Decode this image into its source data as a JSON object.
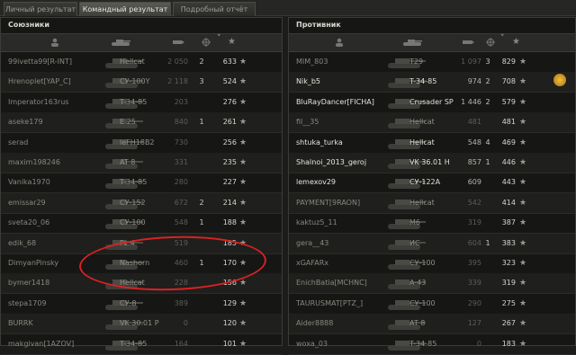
{
  "tabs": [
    {
      "label": "Личный результат",
      "active": false
    },
    {
      "label": "Командный результат",
      "active": true
    },
    {
      "label": "Подробный отчёт",
      "active": false
    }
  ],
  "allies": {
    "title": "Союзники",
    "rows": [
      {
        "name": "99ivetta99[R-INT]",
        "vehicle": "Hellcat",
        "damage": "2 050",
        "kills": "2",
        "xp": "633",
        "bright": false
      },
      {
        "name": "Hrenoplet[YAP_C]",
        "vehicle": "СУ-100Y",
        "damage": "2 118",
        "kills": "3",
        "xp": "524",
        "bright": false
      },
      {
        "name": "Imperator163rus",
        "vehicle": "T-34-85",
        "damage": "203",
        "kills": "",
        "xp": "276",
        "bright": false
      },
      {
        "name": "aseke179",
        "vehicle": "E 25",
        "damage": "840",
        "kills": "1",
        "xp": "261",
        "bright": false
      },
      {
        "name": "serad",
        "vehicle": "leFH18B2",
        "damage": "730",
        "kills": "",
        "xp": "256",
        "bright": false
      },
      {
        "name": "maxim198246",
        "vehicle": "AT 8",
        "damage": "331",
        "kills": "",
        "xp": "235",
        "bright": false
      },
      {
        "name": "Vanika1970",
        "vehicle": "T-34-85",
        "damage": "280",
        "kills": "",
        "xp": "227",
        "bright": false
      },
      {
        "name": "emissar29",
        "vehicle": "СУ-152",
        "damage": "672",
        "kills": "2",
        "xp": "214",
        "bright": false
      },
      {
        "name": "sveta20_06",
        "vehicle": "СУ-100",
        "damage": "548",
        "kills": "1",
        "xp": "188",
        "bright": false
      },
      {
        "name": "edik_68",
        "vehicle": "Pz.4",
        "damage": "519",
        "kills": "",
        "xp": "185",
        "bright": false
      },
      {
        "name": "DimyanPinsky",
        "vehicle": "Nashorn",
        "damage": "460",
        "kills": "1",
        "xp": "170",
        "bright": false
      },
      {
        "name": "bymer1418",
        "vehicle": "Hellcat",
        "damage": "228",
        "kills": "",
        "xp": "156",
        "bright": false
      },
      {
        "name": "stepa1709",
        "vehicle": "СУ-8",
        "damage": "389",
        "kills": "",
        "xp": "129",
        "bright": false
      },
      {
        "name": "BURRK",
        "vehicle": "VK 30.01 P",
        "damage": "0",
        "kills": "",
        "xp": "120",
        "bright": false
      },
      {
        "name": "makgivan[1AZOV]",
        "vehicle": "T-34-85",
        "damage": "164",
        "kills": "",
        "xp": "101",
        "bright": false
      }
    ]
  },
  "enemies": {
    "title": "Противник",
    "rows": [
      {
        "name": "MIM_803",
        "vehicle": "T29",
        "damage": "1 097",
        "kills": "3",
        "xp": "829",
        "bright": false
      },
      {
        "name": "Nik_b5",
        "vehicle": "T-34-85",
        "damage": "974",
        "kills": "2",
        "xp": "708",
        "bright": true
      },
      {
        "name": "BluRayDancer[FICHA]",
        "vehicle": "Crusader SP",
        "damage": "1 446",
        "kills": "2",
        "xp": "579",
        "bright": true
      },
      {
        "name": "fil__35",
        "vehicle": "Hellcat",
        "damage": "481",
        "kills": "",
        "xp": "481",
        "bright": false
      },
      {
        "name": "shtuka_turka",
        "vehicle": "Hellcat",
        "damage": "548",
        "kills": "4",
        "xp": "469",
        "bright": true
      },
      {
        "name": "Shalnoi_2013_geroj",
        "vehicle": "VK 36.01 H",
        "damage": "857",
        "kills": "1",
        "xp": "446",
        "bright": true
      },
      {
        "name": "lemexov29",
        "vehicle": "СУ-122А",
        "damage": "609",
        "kills": "",
        "xp": "443",
        "bright": true
      },
      {
        "name": "PAYMENT[9RAON]",
        "vehicle": "Hellcat",
        "damage": "542",
        "kills": "",
        "xp": "414",
        "bright": false
      },
      {
        "name": "kaktuz5_11",
        "vehicle": "M6",
        "damage": "319",
        "kills": "",
        "xp": "387",
        "bright": false
      },
      {
        "name": "gera__43",
        "vehicle": "ИС",
        "damage": "604",
        "kills": "1",
        "xp": "383",
        "bright": false
      },
      {
        "name": "xGAFARx",
        "vehicle": "СУ-100",
        "damage": "395",
        "kills": "",
        "xp": "323",
        "bright": false
      },
      {
        "name": "EnichBatia[MCHNC]",
        "vehicle": "A-43",
        "damage": "339",
        "kills": "",
        "xp": "319",
        "bright": false
      },
      {
        "name": "TAURUSMAT[PTZ_]",
        "vehicle": "СУ-100",
        "damage": "290",
        "kills": "",
        "xp": "275",
        "bright": false
      },
      {
        "name": "Aider8888",
        "vehicle": "AT 8",
        "damage": "127",
        "kills": "",
        "xp": "267",
        "bright": false
      },
      {
        "name": "woxa_03",
        "vehicle": "T-34-85",
        "damage": "0",
        "kills": "",
        "xp": "183",
        "bright": false
      }
    ]
  },
  "colors": {
    "annotation": "#d82222",
    "star": "#9a9a93"
  },
  "icons": {
    "column_player": "person-icon",
    "column_vehicle": "tank-icon",
    "column_damage": "shell-icon",
    "column_kills": "crosshair-icon",
    "column_xp": "star-icon",
    "row_star": "star-icon",
    "medal": "medal-icon"
  },
  "star_glyph": "★"
}
